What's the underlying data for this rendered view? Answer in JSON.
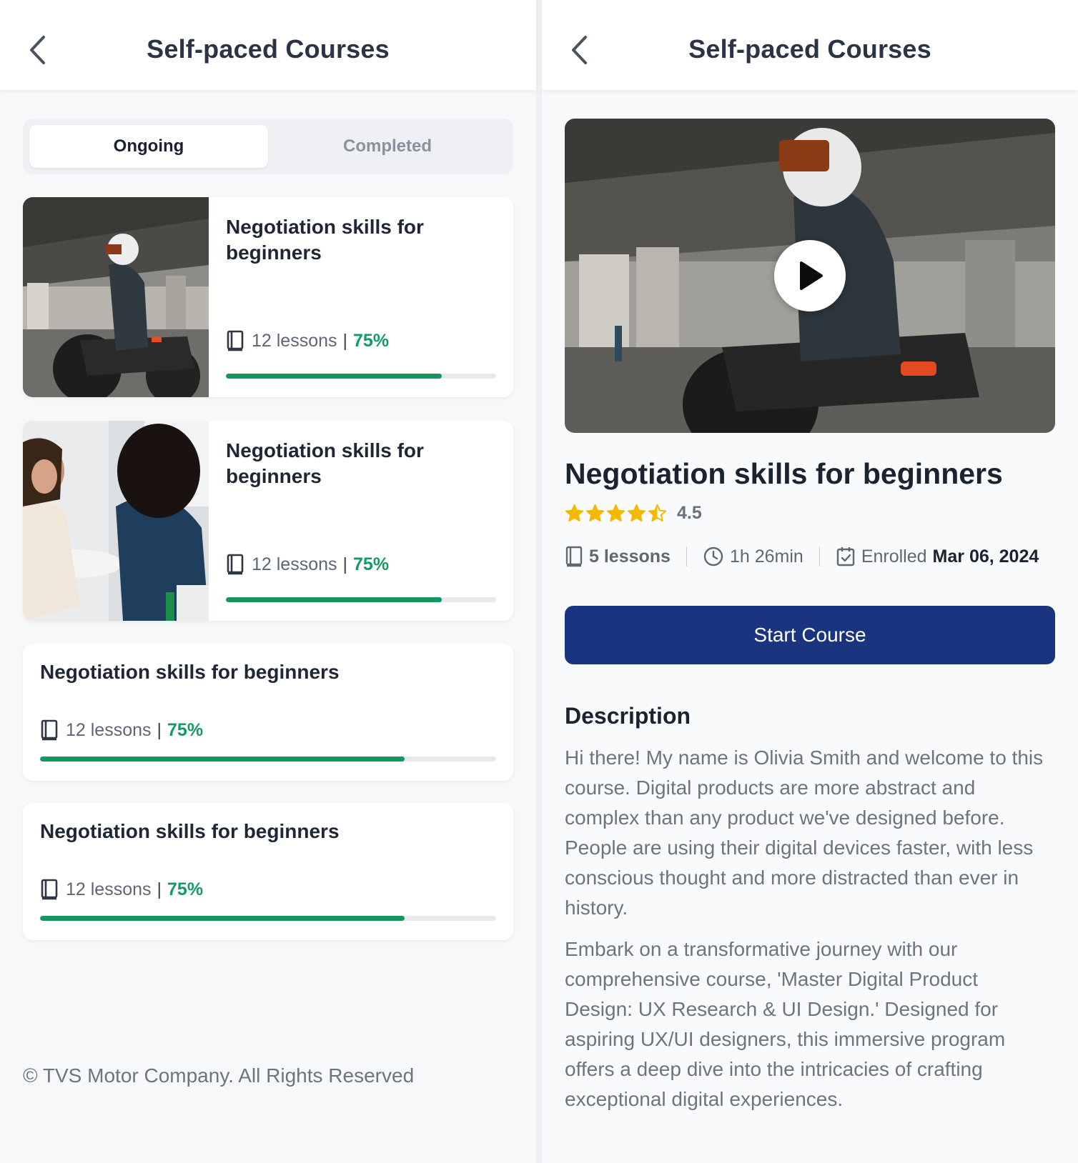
{
  "left": {
    "header": {
      "title": "Self-paced Courses"
    },
    "tabs": [
      {
        "label": "Ongoing",
        "active": true
      },
      {
        "label": "Completed",
        "active": false
      }
    ],
    "courses": [
      {
        "title": "Negotiation skills for beginners",
        "lessons": "12 lessons",
        "separator": "|",
        "progress_label": "75%",
        "progress": 0.8,
        "thumbnail": "motorcycle-rider"
      },
      {
        "title": "Negotiation skills for beginners",
        "lessons": "12 lessons",
        "separator": "|",
        "progress_label": "75%",
        "progress": 0.8,
        "thumbnail": "women-meeting"
      },
      {
        "title": "Negotiation skills for beginners",
        "lessons": "12 lessons",
        "separator": "|",
        "progress_label": "75%",
        "progress": 0.8
      },
      {
        "title": "Negotiation skills for beginners",
        "lessons": "12 lessons",
        "separator": "|",
        "progress_label": "75%",
        "progress": 0.8
      }
    ],
    "footer": "© TVS Motor Company. All Rights Reserved"
  },
  "right": {
    "header": {
      "title": "Self-paced Courses"
    },
    "course": {
      "title": "Negotiation skills for beginners",
      "rating": "4.5",
      "rating_value": 4.5,
      "lessons": "5 lessons",
      "duration": "1h 26min",
      "enrolled_label": "Enrolled",
      "enrolled_date": "Mar 06, 2024",
      "cta": "Start Course",
      "description_heading": "Description",
      "description": [
        "Hi there! My name is Olivia Smith and welcome to this course. Digital products are more abstract and complex than any product we've designed before. People are using their digital devices faster, with less conscious thought and more distracted than ever in history.",
        "Embark on a transformative journey with our comprehensive course, 'Master Digital Product Design: UX Research & UI Design.' Designed for aspiring UX/UI designers, this immersive program offers a deep dive into the intricacies of crafting exceptional digital experiences."
      ]
    }
  },
  "colors": {
    "accent_green": "#169a64",
    "primary_button": "#1a3480",
    "star": "#f5b800"
  }
}
